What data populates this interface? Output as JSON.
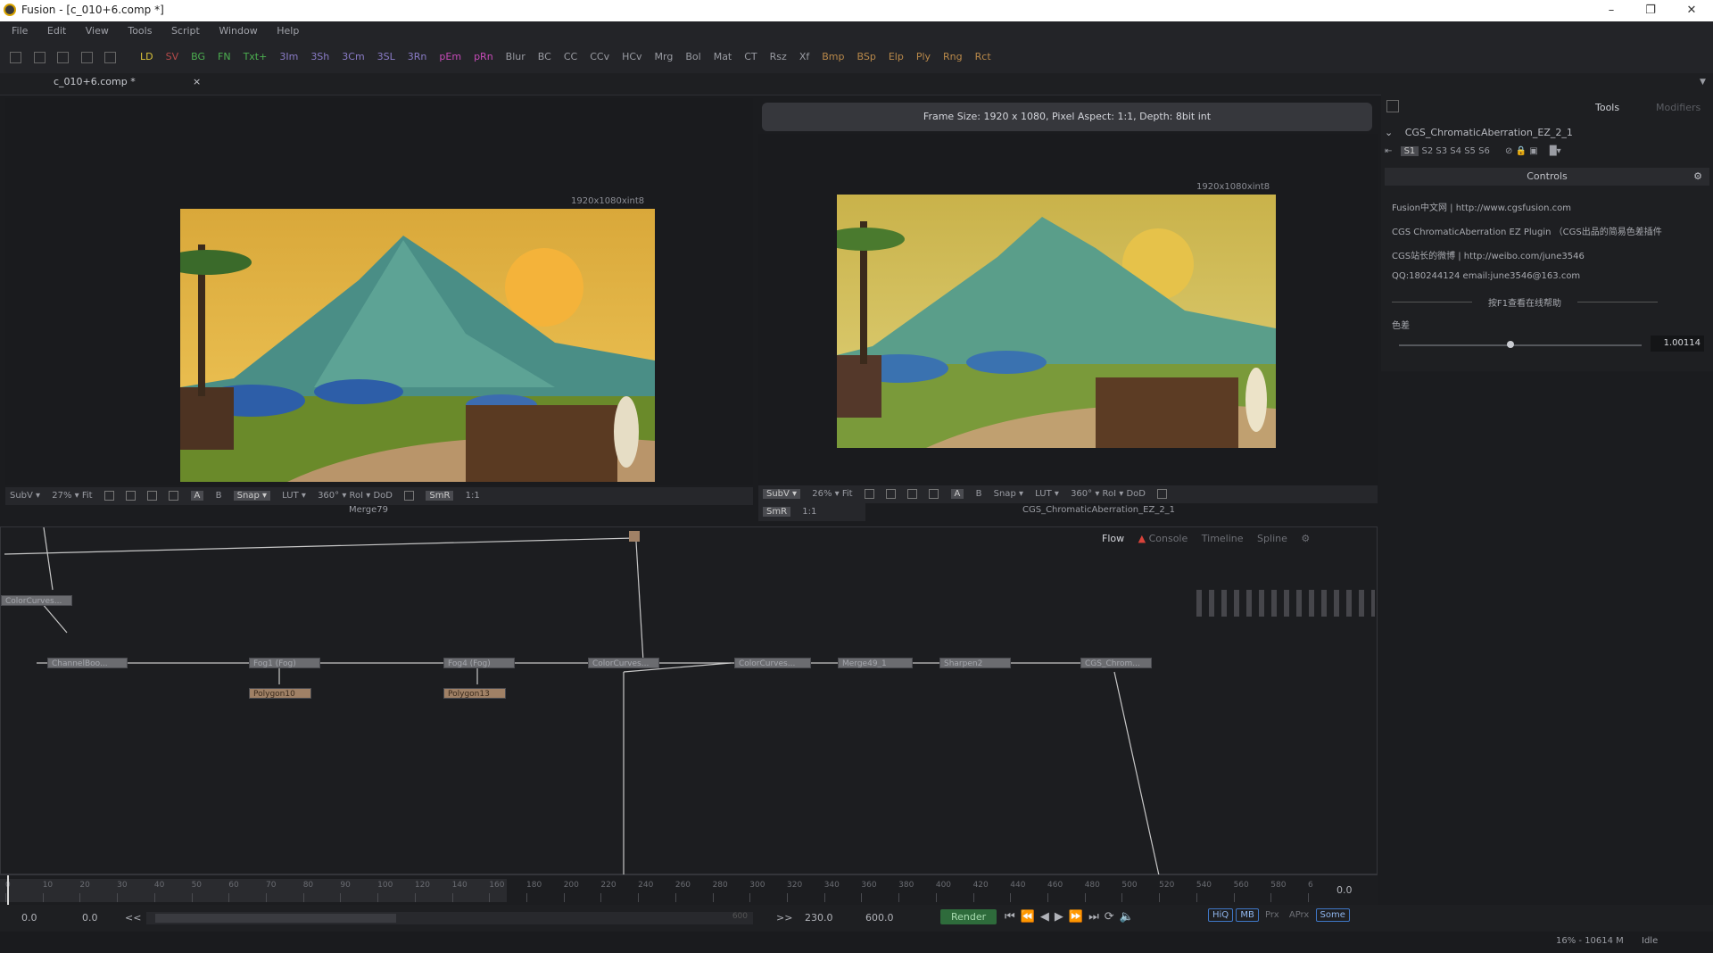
{
  "window": {
    "title": "Fusion - [c_010+6.comp *]",
    "minimize": "–",
    "restore": "❐",
    "close": "✕"
  },
  "menu": [
    "File",
    "Edit",
    "View",
    "Tools",
    "Script",
    "Window",
    "Help"
  ],
  "toolbar": [
    {
      "label": "LD",
      "color": "#d9c23a"
    },
    {
      "label": "SV",
      "color": "#b54a4a"
    },
    {
      "label": "BG",
      "color": "#4caf50"
    },
    {
      "label": "FN",
      "color": "#4caf50"
    },
    {
      "label": "Txt+",
      "color": "#4caf50"
    },
    {
      "label": "3Im",
      "color": "#8a7cc7"
    },
    {
      "label": "3Sh",
      "color": "#8a7cc7"
    },
    {
      "label": "3Cm",
      "color": "#8a7cc7"
    },
    {
      "label": "3SL",
      "color": "#8a7cc7"
    },
    {
      "label": "3Rn",
      "color": "#8a7cc7"
    },
    {
      "label": "pEm",
      "color": "#c74bb8"
    },
    {
      "label": "pRn",
      "color": "#c74bb8"
    },
    {
      "label": "Blur",
      "color": "#9a9ca3"
    },
    {
      "label": "BC",
      "color": "#9a9ca3"
    },
    {
      "label": "CC",
      "color": "#9a9ca3"
    },
    {
      "label": "CCv",
      "color": "#9a9ca3"
    },
    {
      "label": "HCv",
      "color": "#9a9ca3"
    },
    {
      "label": "Mrg",
      "color": "#9a9ca3"
    },
    {
      "label": "Bol",
      "color": "#9a9ca3"
    },
    {
      "label": "Mat",
      "color": "#9a9ca3"
    },
    {
      "label": "CT",
      "color": "#9a9ca3"
    },
    {
      "label": "Rsz",
      "color": "#9a9ca3"
    },
    {
      "label": "Xf",
      "color": "#9a9ca3"
    },
    {
      "label": "Bmp",
      "color": "#b9894a"
    },
    {
      "label": "BSp",
      "color": "#b9894a"
    },
    {
      "label": "Elp",
      "color": "#b9894a"
    },
    {
      "label": "Ply",
      "color": "#b9894a"
    },
    {
      "label": "Rng",
      "color": "#b9894a"
    },
    {
      "label": "Rct",
      "color": "#b9894a"
    }
  ],
  "tab": {
    "name": "c_010+6.comp *",
    "close": "×"
  },
  "viewer_left": {
    "resolution": "1920x1080xint8",
    "toolbar": [
      "SubV ▾",
      "27% ▾ Fit"
    ],
    "toolbar_right": [
      "A",
      "B",
      "Snap ▾",
      "LUT ▾",
      "360° ▾ RoI ▾ DoD",
      "SmR",
      "1:1"
    ],
    "caption": "Merge79"
  },
  "viewer_right": {
    "frame_info": "Frame Size: 1920 x 1080, Pixel Aspect: 1:1, Depth: 8bit int",
    "resolution": "1920x1080xint8",
    "toolbar": [
      "SubV ▾",
      "26% ▾ Fit"
    ],
    "toolbar_right": [
      "A",
      "B",
      "Snap ▾",
      "LUT ▾",
      "360° ▾ RoI ▾ DoD"
    ],
    "toolbar_row2": [
      "SmR",
      "1:1"
    ],
    "caption": "CGS_ChromaticAberration_EZ_2_1"
  },
  "inspector": {
    "tabs": [
      "Tools",
      "Modifiers"
    ],
    "tool_name": "CGS_ChromaticAberration_EZ_2_1",
    "slots": [
      "S1",
      "S2",
      "S3",
      "S4",
      "S5",
      "S6"
    ],
    "controls_label": "Controls",
    "lines": [
      "Fusion中文网 | http://www.cgsfusion.com",
      "CGS ChromaticAberration EZ Plugin （CGS出品的简易色差插件",
      "CGS站长的微博 | http://weibo.com/june3546",
      "QQ:180244124   email:june3546@163.com",
      "按F1查看在线帮助"
    ],
    "param_label": "色差",
    "param_value": "1.00114",
    "param_level": 0.46
  },
  "flow": {
    "tabs": [
      "Flow",
      "Console",
      "Timeline",
      "Spline"
    ],
    "nodes": [
      {
        "id": "colorcurves-top",
        "label": "ColorCurves...",
        "mask": false
      },
      {
        "id": "channelboo",
        "label": "ChannelBoo...",
        "mask": false
      },
      {
        "id": "fog1",
        "label": "Fog1 (Fog)",
        "mask": false
      },
      {
        "id": "polygon10",
        "label": "Polygon10",
        "mask": true
      },
      {
        "id": "fog4",
        "label": "Fog4 (Fog)",
        "mask": false
      },
      {
        "id": "polygon13",
        "label": "Polygon13",
        "mask": true
      },
      {
        "id": "colorcurves-a",
        "label": "ColorCurves...",
        "mask": false
      },
      {
        "id": "colorcurves-b",
        "label": "ColorCurves...",
        "mask": false
      },
      {
        "id": "merge49",
        "label": "Merge49_1",
        "mask": false
      },
      {
        "id": "sharpen2",
        "label": "Sharpen2",
        "mask": false
      },
      {
        "id": "cgs-chrom",
        "label": "CGS_Chrom...",
        "mask": false
      }
    ]
  },
  "timeline": {
    "ticks": [
      "0",
      "10",
      "20",
      "30",
      "40",
      "50",
      "60",
      "70",
      "80",
      "90",
      "100",
      "120",
      "140",
      "160",
      "180",
      "200",
      "220",
      "240",
      "260",
      "280",
      "300",
      "320",
      "340",
      "360",
      "380",
      "400",
      "420",
      "440",
      "460",
      "480",
      "500",
      "520",
      "540",
      "560",
      "580",
      "6"
    ],
    "current": "0.0"
  },
  "bottom": {
    "global_start": "0.0",
    "render_start": "0.0",
    "rewind": "<<",
    "slider_end": "600",
    "ff": ">>",
    "render_end": "230.0",
    "global_end": "600.0",
    "render": "Render",
    "transport": [
      "⏮",
      "⏪",
      "◀",
      "▶",
      "⏩",
      "⏭"
    ],
    "loop": "⟳",
    "audio": "🔈",
    "modes": [
      "HiQ",
      "MB",
      "Prx",
      "APrx",
      "Some"
    ]
  },
  "status": {
    "memory": "16% - 10614 M",
    "state": "Idle"
  }
}
